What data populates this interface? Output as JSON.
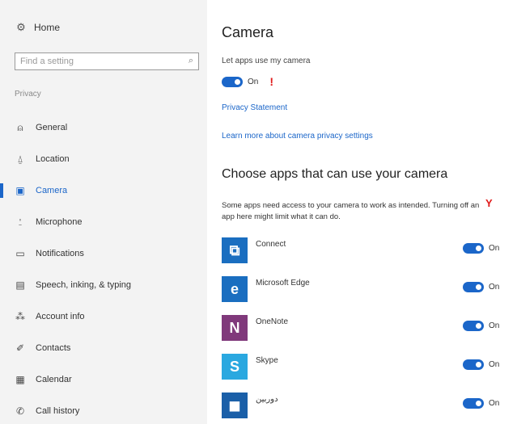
{
  "sidebar": {
    "home_label": "Home",
    "search_placeholder": "Find a setting",
    "section_label": "Privacy",
    "items": [
      {
        "label": "General",
        "icon": "lock-icon",
        "glyph": "⍝"
      },
      {
        "label": "Location",
        "icon": "location-icon",
        "glyph": "⍙"
      },
      {
        "label": "Camera",
        "icon": "camera-icon",
        "glyph": "▣",
        "active": true
      },
      {
        "label": "Microphone",
        "icon": "microphone-icon",
        "glyph": "⍘"
      },
      {
        "label": "Notifications",
        "icon": "notifications-icon",
        "glyph": "▭"
      },
      {
        "label": "Speech, inking, & typing",
        "icon": "speech-icon",
        "glyph": "▤"
      },
      {
        "label": "Account info",
        "icon": "account-info-icon",
        "glyph": "⁂"
      },
      {
        "label": "Contacts",
        "icon": "contacts-icon",
        "glyph": "✐"
      },
      {
        "label": "Calendar",
        "icon": "calendar-icon",
        "glyph": "▦"
      },
      {
        "label": "Call history",
        "icon": "call-history-icon",
        "glyph": "✆"
      }
    ]
  },
  "main": {
    "title": "Camera",
    "allow_label": "Let apps use my camera",
    "master_toggle": {
      "state": "On",
      "on": true
    },
    "privacy_link": "Privacy Statement",
    "learn_link": "Learn more about camera privacy settings",
    "choose_title": "Choose apps that can use your camera",
    "choose_desc": "Some apps need access to your camera to work as intended. Turning off an app here might limit what it can do.",
    "apps": [
      {
        "name": "Connect",
        "icon": "connect-icon",
        "glyph": "⧉",
        "color": "#1a6ec0",
        "state": "On"
      },
      {
        "name": "Microsoft Edge",
        "icon": "edge-icon",
        "glyph": "e",
        "color": "#1a6ec0",
        "state": "On"
      },
      {
        "name": "OneNote",
        "icon": "onenote-icon",
        "glyph": "N",
        "color": "#80397b",
        "state": "On"
      },
      {
        "name": "Skype",
        "icon": "skype-icon",
        "glyph": "S",
        "color": "#2aa8e0",
        "state": "On"
      },
      {
        "name": "دوربین",
        "icon": "camera-app-icon",
        "glyph": "◼",
        "color": "#1a5fa8",
        "state": "On"
      }
    ]
  },
  "colors": {
    "accent": "#1b66c9",
    "marker": "#e01b1b"
  }
}
